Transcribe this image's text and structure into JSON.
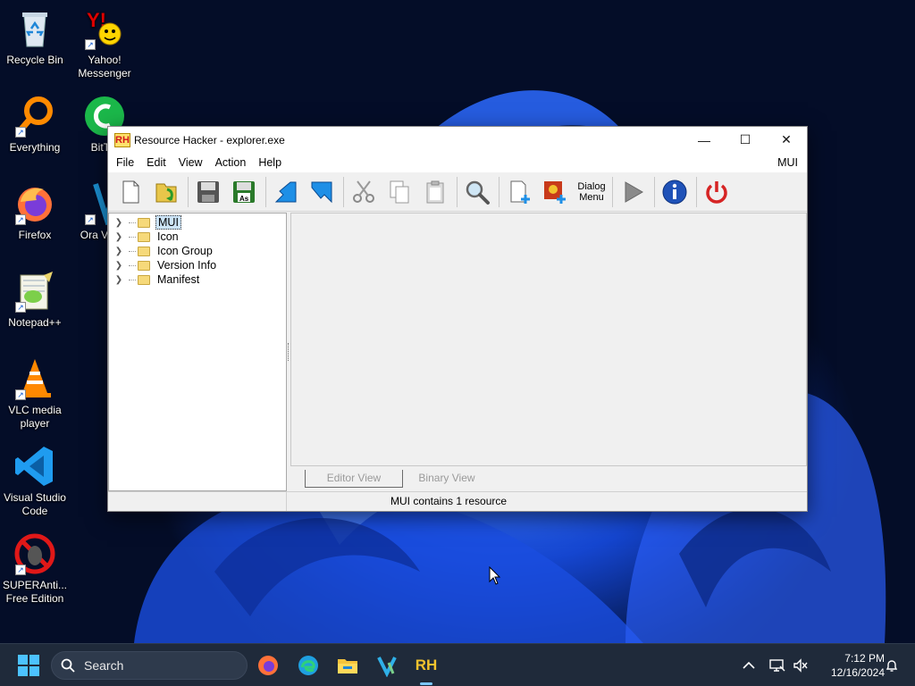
{
  "desktop": {
    "icons": [
      {
        "label": "Recycle Bin"
      },
      {
        "label": "Yahoo! Messenger"
      },
      {
        "label": "Everything"
      },
      {
        "label": "BitTor"
      },
      {
        "label": "Firefox"
      },
      {
        "label": "Ora Virtua"
      },
      {
        "label": "Notepad++"
      },
      {
        "label": "VLC media player"
      },
      {
        "label": "Visual Studio Code"
      },
      {
        "label": "SUPERAnti... Free Edition"
      }
    ]
  },
  "window": {
    "title": "Resource Hacker - explorer.exe",
    "app_icon_text": "RH",
    "controls": {
      "minimize": "—",
      "maximize": "☐",
      "close": "✕"
    },
    "menu": [
      "File",
      "Edit",
      "View",
      "Action",
      "Help"
    ],
    "menu_right": "MUI",
    "toolbar": {
      "dialog_menu_line1": "Dialog",
      "dialog_menu_line2": "Menu"
    },
    "tree": [
      {
        "label": "MUI",
        "selected": true
      },
      {
        "label": "Icon"
      },
      {
        "label": "Icon Group"
      },
      {
        "label": "Version Info"
      },
      {
        "label": "Manifest"
      }
    ],
    "view_tabs": {
      "editor": "Editor View",
      "binary": "Binary View"
    },
    "status": "MUI contains 1 resource"
  },
  "taskbar": {
    "search_placeholder": "Search",
    "time": "7:12 PM",
    "date": "12/16/2024",
    "rh_label": "RH",
    "accent": "#4cc2ff"
  }
}
